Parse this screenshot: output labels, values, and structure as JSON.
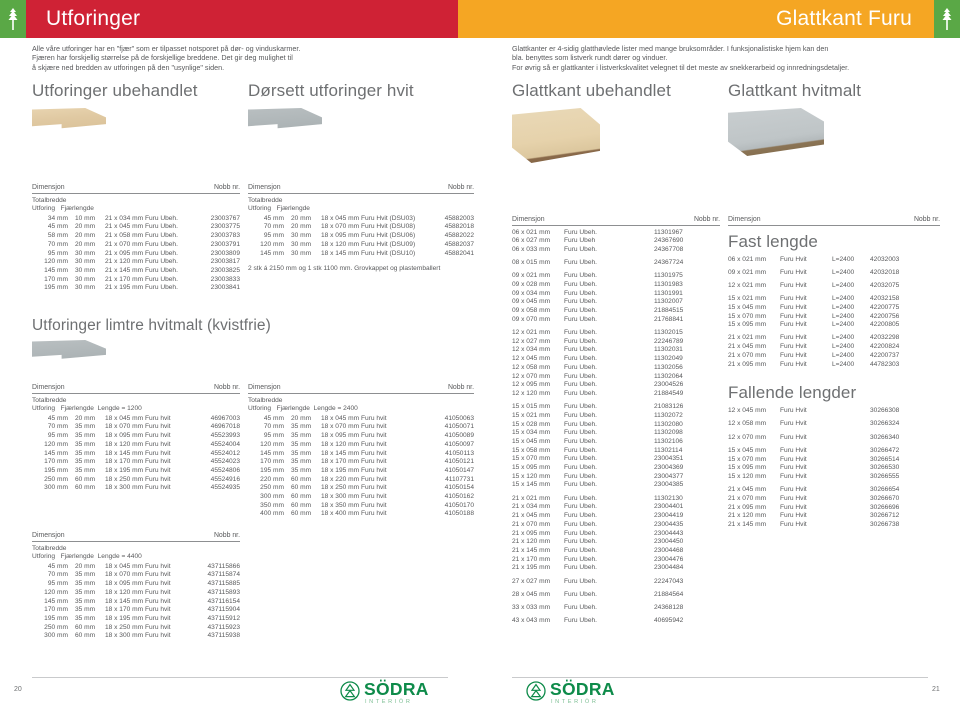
{
  "banner": {
    "left_title": "Utforinger",
    "right_title": "Glattkant Furu",
    "left_color": "#cf2235",
    "right_color": "#f5a623",
    "leaf_color": "#5aa846"
  },
  "intro_left": [
    "Alle våre utforinger har en \"fjær\" som er tilpasset notsporet på dør- og vinduskarmer.",
    "Fjæren har forskjellig størrelse på de forskjellige breddene. Det gir deg mulighet til",
    "å skjære ned bredden av utforingen på den \"usynlige\" siden."
  ],
  "intro_right": [
    "Glattkanter er 4-sidig glatthøvlede lister med mange bruksområder. I funksjonalistiske hjem kan den",
    "bla. benyttes som listverk rundt dører og vinduer.",
    "For øvrig så er glattkanter i listverkskvalitet velegnet til det meste av snekkerarbeid og innredningsdetaljer."
  ],
  "headings": {
    "utforinger_ubehandlet": "Utforinger ubehandlet",
    "dorsett_hvit": "Dørsett utforinger hvit",
    "limtre_hvitmalt": "Utforinger limtre hvitmalt (kvistfrie)",
    "glattkant_ubehandlet": "Glattkant ubehandlet",
    "glattkant_hvitmalt": "Glattkant hvitmalt",
    "fast_lengde": "Fast lengde",
    "fallende_lengder": "Fallende lengder"
  },
  "table_labels": {
    "dimensjon": "Dimensjon",
    "nobb": "Nobb nr.",
    "totalbredde": "Totalbredde",
    "utforing": "Utforing",
    "fjaerlengde": "Fjærlengde",
    "lengde_1200": "Lengde = 1200",
    "lengde_2400": "Lengde = 2400",
    "lengde_4400": "Lengde = 4400"
  },
  "tables": {
    "utforinger_ubehandlet": {
      "rows": [
        {
          "utforing": "34 mm",
          "fjaer": "10 mm",
          "dim": "21 x 034 mm  Furu  Ubeh.",
          "nobb": "23003767"
        },
        {
          "utforing": "45 mm",
          "fjaer": "20 mm",
          "dim": "21 x 045 mm  Furu  Ubeh.",
          "nobb": "23003775"
        },
        {
          "utforing": "58 mm",
          "fjaer": "20 mm",
          "dim": "21 x 058 mm  Furu  Ubeh.",
          "nobb": "23003783"
        },
        {
          "utforing": "70 mm",
          "fjaer": "20 mm",
          "dim": "21 x 070 mm  Furu  Ubeh.",
          "nobb": "23003791"
        },
        {
          "utforing": "95 mm",
          "fjaer": "30 mm",
          "dim": "21 x 095 mm  Furu  Ubeh.",
          "nobb": "23003809"
        },
        {
          "utforing": "120 mm",
          "fjaer": "30 mm",
          "dim": "21 x 120 mm  Furu  Ubeh.",
          "nobb": "23003817"
        },
        {
          "utforing": "145 mm",
          "fjaer": "30 mm",
          "dim": "21 x 145 mm  Furu  Ubeh.",
          "nobb": "23003825"
        },
        {
          "utforing": "170 mm",
          "fjaer": "30 mm",
          "dim": "21 x 170 mm  Furu  Ubeh.",
          "nobb": "23003833"
        },
        {
          "utforing": "195 mm",
          "fjaer": "30 mm",
          "dim": "21 x 195 mm  Furu  Ubeh.",
          "nobb": "23003841"
        }
      ]
    },
    "dorsett_hvit": {
      "rows": [
        {
          "utforing": "45 mm",
          "fjaer": "20 mm",
          "dim": "18 x 045 mm Furu Hvit (DSU03)",
          "nobb": "45882003"
        },
        {
          "utforing": "70 mm",
          "fjaer": "20 mm",
          "dim": "18 x 070 mm Furu Hvit (DSU08)",
          "nobb": "45882018"
        },
        {
          "utforing": "95 mm",
          "fjaer": "30 mm",
          "dim": "18 x 095 mm Furu Hvit (DSU06)",
          "nobb": "45882022"
        },
        {
          "utforing": "120 mm",
          "fjaer": "30 mm",
          "dim": "18 x 120 mm Furu Hvit (DSU09)",
          "nobb": "45882037"
        },
        {
          "utforing": "145 mm",
          "fjaer": "30 mm",
          "dim": "18 x 145 mm Furu Hvit (DSU10)",
          "nobb": "45882041"
        }
      ],
      "note": "2 stk á 2150 mm og 1 stk 1100 mm. Grovkappet og plastemballert"
    },
    "limtre_1200": {
      "rows": [
        {
          "utforing": "45 mm",
          "fjaer": "20 mm",
          "dim": "18 x 045 mm Furu hvit",
          "nobb": "46967003"
        },
        {
          "utforing": "70 mm",
          "fjaer": "35 mm",
          "dim": "18 x 070 mm Furu hvit",
          "nobb": "46967018"
        },
        {
          "utforing": "95 mm",
          "fjaer": "35 mm",
          "dim": "18 x 095 mm Furu hvit",
          "nobb": "45523993"
        },
        {
          "utforing": "120 mm",
          "fjaer": "35 mm",
          "dim": "18 x 120 mm Furu hvit",
          "nobb": "45524004"
        },
        {
          "utforing": "145 mm",
          "fjaer": "35 mm",
          "dim": "18 x 145 mm Furu hvit",
          "nobb": "45524012"
        },
        {
          "utforing": "170 mm",
          "fjaer": "35 mm",
          "dim": "18 x 170 mm Furu hvit",
          "nobb": "45524023"
        },
        {
          "utforing": "195 mm",
          "fjaer": "35 mm",
          "dim": "18 x 195 mm Furu hvit",
          "nobb": "45524806"
        },
        {
          "utforing": "250 mm",
          "fjaer": "60 mm",
          "dim": "18 x 250 mm Furu hvit",
          "nobb": "45524916"
        },
        {
          "utforing": "300 mm",
          "fjaer": "60 mm",
          "dim": "18 x 300 mm Furu hvit",
          "nobb": "45524935"
        }
      ]
    },
    "limtre_4400": {
      "rows": [
        {
          "utforing": "45 mm",
          "fjaer": "20 mm",
          "dim": "18 x 045 mm Furu hvit",
          "nobb": "437115866"
        },
        {
          "utforing": "70 mm",
          "fjaer": "35 mm",
          "dim": "18 x 070 mm Furu hvit",
          "nobb": "437115874"
        },
        {
          "utforing": "95 mm",
          "fjaer": "35 mm",
          "dim": "18 x 095 mm Furu hvit",
          "nobb": "437115885"
        },
        {
          "utforing": "120 mm",
          "fjaer": "35 mm",
          "dim": "18 x 120 mm Furu hvit",
          "nobb": "437115893"
        },
        {
          "utforing": "145 mm",
          "fjaer": "35 mm",
          "dim": "18 x 145 mm Furu hvit",
          "nobb": "437116154"
        },
        {
          "utforing": "170 mm",
          "fjaer": "35 mm",
          "dim": "18 x 170 mm Furu hvit",
          "nobb": "437115904"
        },
        {
          "utforing": "195 mm",
          "fjaer": "35 mm",
          "dim": "18 x 195 mm Furu hvit",
          "nobb": "437115912"
        },
        {
          "utforing": "250 mm",
          "fjaer": "60 mm",
          "dim": "18 x 250 mm Furu hvit",
          "nobb": "437115923"
        },
        {
          "utforing": "300 mm",
          "fjaer": "60 mm",
          "dim": "18 x 300 mm Furu hvit",
          "nobb": "437115938"
        }
      ]
    },
    "limtre_2400": {
      "rows": [
        {
          "utforing": "45 mm",
          "fjaer": "20 mm",
          "dim": "18 x 045 mm Furu hvit",
          "nobb": "41050063"
        },
        {
          "utforing": "70 mm",
          "fjaer": "35 mm",
          "dim": "18 x 070 mm Furu hvit",
          "nobb": "41050071"
        },
        {
          "utforing": "95 mm",
          "fjaer": "35 mm",
          "dim": "18 x 095 mm Furu hvit",
          "nobb": "41050089"
        },
        {
          "utforing": "120 mm",
          "fjaer": "35 mm",
          "dim": "18 x 120 mm Furu hvit",
          "nobb": "41050097"
        },
        {
          "utforing": "145 mm",
          "fjaer": "35 mm",
          "dim": "18 x 145 mm Furu hvit",
          "nobb": "41050113"
        },
        {
          "utforing": "170 mm",
          "fjaer": "35 mm",
          "dim": "18 x 170 mm Furu hvit",
          "nobb": "41050121"
        },
        {
          "utforing": "195 mm",
          "fjaer": "35 mm",
          "dim": "18 x 195 mm Furu hvit",
          "nobb": "41050147"
        },
        {
          "utforing": "220 mm",
          "fjaer": "60 mm",
          "dim": "18 x 220 mm Furu hvit",
          "nobb": "41107731"
        },
        {
          "utforing": "250 mm",
          "fjaer": "60 mm",
          "dim": "18 x 250 mm Furu hvit",
          "nobb": "41050154"
        },
        {
          "utforing": "300 mm",
          "fjaer": "60 mm",
          "dim": "18 x 300 mm Furu hvit",
          "nobb": "41050162"
        },
        {
          "utforing": "350 mm",
          "fjaer": "60 mm",
          "dim": "18 x 350 mm Furu hvit",
          "nobb": "41050170"
        },
        {
          "utforing": "400 mm",
          "fjaer": "60 mm",
          "dim": "18 x 400 mm Furu hvit",
          "nobb": "41050188"
        }
      ]
    },
    "glattkant_ubehandlet": {
      "rows": [
        {
          "dim": "06 x 021 mm",
          "mat": "Furu Ubeh.",
          "nobb": "11301967",
          "gap": false
        },
        {
          "dim": "06 x 027 mm",
          "mat": "Furu Ubeh",
          "nobb": "24367690",
          "gap": false
        },
        {
          "dim": "06 x 033 mm",
          "mat": "Furu Ubeh.",
          "nobb": "24367708",
          "gap": false
        },
        {
          "dim": "08 x 015 mm",
          "mat": "Furu Ubeh.",
          "nobb": "24367724",
          "gap": true
        },
        {
          "dim": "09 x 021 mm",
          "mat": "Furu Ubeh.",
          "nobb": "11301975",
          "gap": true
        },
        {
          "dim": "09 x 028 mm",
          "mat": "Furu Ubeh.",
          "nobb": "11301983",
          "gap": false
        },
        {
          "dim": "09 x 034 mm",
          "mat": "Furu Ubeh.",
          "nobb": "11301991",
          "gap": false
        },
        {
          "dim": "09 x 045 mm",
          "mat": "Furu Ubeh.",
          "nobb": "11302007",
          "gap": false
        },
        {
          "dim": "09 x 058 mm",
          "mat": "Furu Ubeh.",
          "nobb": "21884515",
          "gap": false
        },
        {
          "dim": "09 x 070 mm",
          "mat": "Furu Ubeh.",
          "nobb": "21768841",
          "gap": false
        },
        {
          "dim": "12 x 021 mm",
          "mat": "Furu Ubeh.",
          "nobb": "11302015",
          "gap": true
        },
        {
          "dim": "12 x 027 mm",
          "mat": "Furu Ubeh.",
          "nobb": "22246789",
          "gap": false
        },
        {
          "dim": "12 x 034 mm",
          "mat": "Furu Ubeh.",
          "nobb": "11302031",
          "gap": false
        },
        {
          "dim": "12 x 045 mm",
          "mat": "Furu Ubeh.",
          "nobb": "11302049",
          "gap": false
        },
        {
          "dim": "12 x 058 mm",
          "mat": "Furu Ubeh.",
          "nobb": "11302056",
          "gap": false
        },
        {
          "dim": "12 x 070 mm",
          "mat": "Furu Ubeh.",
          "nobb": "11302064",
          "gap": false
        },
        {
          "dim": "12 x 095 mm",
          "mat": "Furu Ubeh.",
          "nobb": "23004526",
          "gap": false
        },
        {
          "dim": "12 x 120 mm",
          "mat": "Furu Ubeh.",
          "nobb": "21884549",
          "gap": false
        },
        {
          "dim": "15 x 015 mm",
          "mat": "Furu Ubeh.",
          "nobb": "21083126",
          "gap": true
        },
        {
          "dim": "15 x 021 mm",
          "mat": "Furu Ubeh.",
          "nobb": "11302072",
          "gap": false
        },
        {
          "dim": "15 x 028 mm",
          "mat": "Furu Ubeh.",
          "nobb": "11302080",
          "gap": false
        },
        {
          "dim": "15 x 034 mm",
          "mat": "Furu Ubeh.",
          "nobb": "11302098",
          "gap": false
        },
        {
          "dim": "15 x 045 mm",
          "mat": "Furu Ubeh.",
          "nobb": "11302106",
          "gap": false
        },
        {
          "dim": "15 x 058 mm",
          "mat": "Furu Ubeh.",
          "nobb": "11302114",
          "gap": false
        },
        {
          "dim": "15 x 070 mm",
          "mat": "Furu Ubeh.",
          "nobb": "23004351",
          "gap": false
        },
        {
          "dim": "15 x 095 mm",
          "mat": "Furu Ubeh.",
          "nobb": "23004369",
          "gap": false
        },
        {
          "dim": "15 x 120 mm",
          "mat": "Furu Ubeh.",
          "nobb": "23004377",
          "gap": false
        },
        {
          "dim": "15 x 145 mm",
          "mat": "Furu Ubeh.",
          "nobb": "23004385",
          "gap": false
        },
        {
          "dim": "21 x 021 mm",
          "mat": "Furu Ubeh.",
          "nobb": "11302130",
          "gap": true
        },
        {
          "dim": "21 x 034 mm",
          "mat": "Furu Ubeh.",
          "nobb": "23004401",
          "gap": false
        },
        {
          "dim": "21 x 045 mm",
          "mat": "Furu Ubeh.",
          "nobb": "23004419",
          "gap": false
        },
        {
          "dim": "21 x 070 mm",
          "mat": "Furu Ubeh.",
          "nobb": "23004435",
          "gap": false
        },
        {
          "dim": "21 x 095 mm",
          "mat": "Furu Ubeh.",
          "nobb": "23004443",
          "gap": false
        },
        {
          "dim": "21 x 120 mm",
          "mat": "Furu Ubeh.",
          "nobb": "23004450",
          "gap": false
        },
        {
          "dim": "21 x 145 mm",
          "mat": "Furu Ubeh.",
          "nobb": "23004468",
          "gap": false
        },
        {
          "dim": "21 x 170 mm",
          "mat": "Furu Ubeh.",
          "nobb": "23004476",
          "gap": false
        },
        {
          "dim": "21 x 195 mm",
          "mat": "Furu Ubeh.",
          "nobb": "23004484",
          "gap": false
        },
        {
          "dim": "27 x 027 mm",
          "mat": "Furu Ubeh.",
          "nobb": "22247043",
          "gap": true
        },
        {
          "dim": "28 x 045 mm",
          "mat": "Furu Ubeh.",
          "nobb": "21884564",
          "gap": true
        },
        {
          "dim": "33 x 033 mm",
          "mat": "Furu Ubeh.",
          "nobb": "24368128",
          "gap": true
        },
        {
          "dim": "43 x 043 mm",
          "mat": "Furu Ubeh.",
          "nobb": "40695942",
          "gap": true
        }
      ]
    },
    "glattkant_fast_lengde": {
      "rows": [
        {
          "dim": "06 x 021 mm",
          "mat": "Furu Hvit",
          "len": "L=2400",
          "nobb": "42032003",
          "gap": false
        },
        {
          "dim": "09 x 021 mm",
          "mat": "Furu Hvit",
          "len": "L=2400",
          "nobb": "42032018",
          "gap": true
        },
        {
          "dim": "12 x 021 mm",
          "mat": "Furu Hvit",
          "len": "L=2400",
          "nobb": "42032075",
          "gap": true
        },
        {
          "dim": "15 x 021 mm",
          "mat": "Furu Hvit",
          "len": "L=2400",
          "nobb": "42032158",
          "gap": true
        },
        {
          "dim": "15 x 045 mm",
          "mat": "Furu Hvit",
          "len": "L=2400",
          "nobb": "42200775",
          "gap": false
        },
        {
          "dim": "15 x 070 mm",
          "mat": "Furu Hvit",
          "len": "L=2400",
          "nobb": "42200756",
          "gap": false
        },
        {
          "dim": "15 x 095 mm",
          "mat": "Furu Hvit",
          "len": "L=2400",
          "nobb": "42200805",
          "gap": false
        },
        {
          "dim": "21 x 021 mm",
          "mat": "Furu Hvit",
          "len": "L=2400",
          "nobb": "42032298",
          "gap": true
        },
        {
          "dim": "21 x 045 mm",
          "mat": "Furu Hvit",
          "len": "L=2400",
          "nobb": "42200824",
          "gap": false
        },
        {
          "dim": "21 x 070 mm",
          "mat": "Furu Hvit",
          "len": "L=2400",
          "nobb": "42200737",
          "gap": false
        },
        {
          "dim": "21 x 095 mm",
          "mat": "Furu Hvit",
          "len": "L=2400",
          "nobb": "44782303",
          "gap": false
        }
      ]
    },
    "glattkant_fallende": {
      "rows": [
        {
          "dim": "12 x 045 mm",
          "mat": "Furu Hvit",
          "nobb": "30266308",
          "gap": false
        },
        {
          "dim": "12 x 058 mm",
          "mat": "Furu Hvit",
          "nobb": "30266324",
          "gap": true
        },
        {
          "dim": "12 x 070 mm",
          "mat": "Furu Hvit",
          "nobb": "30266340",
          "gap": true
        },
        {
          "dim": "15 x 045 mm",
          "mat": "Furu Hvit",
          "nobb": "30266472",
          "gap": true
        },
        {
          "dim": "15 x 070 mm",
          "mat": "Furu Hvit",
          "nobb": "30266514",
          "gap": false
        },
        {
          "dim": "15 x 095 mm",
          "mat": "Furu Hvit",
          "nobb": "30266530",
          "gap": false
        },
        {
          "dim": "15 x 120 mm",
          "mat": "Furu Hvit",
          "nobb": "30266555",
          "gap": false
        },
        {
          "dim": "21 x 045 mm",
          "mat": "Furu Hvit",
          "nobb": "30266654",
          "gap": true
        },
        {
          "dim": "21 x 070 mm",
          "mat": "Furu Hvit",
          "nobb": "30266670",
          "gap": false
        },
        {
          "dim": "21 x 095 mm",
          "mat": "Furu Hvit",
          "nobb": "30266696",
          "gap": false
        },
        {
          "dim": "21 x 120 mm",
          "mat": "Furu Hvit",
          "nobb": "30266712",
          "gap": false
        },
        {
          "dim": "21 x 145 mm",
          "mat": "Furu Hvit",
          "nobb": "30266738",
          "gap": false
        }
      ]
    }
  },
  "footer": {
    "page_left": "20",
    "page_right": "21",
    "logo_word": "SÖDRA",
    "logo_sub": "INTERIÖR",
    "logo_color": "#0e8b4a"
  }
}
